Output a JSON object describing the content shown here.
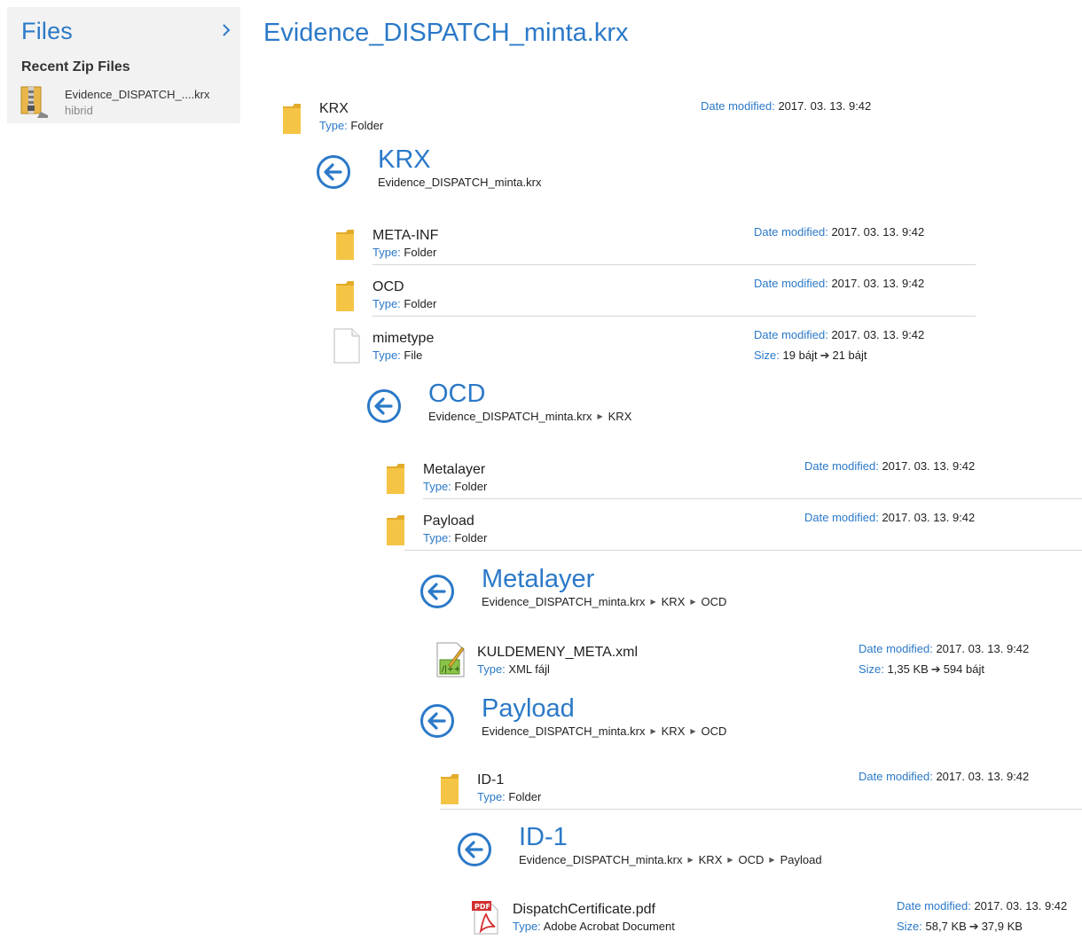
{
  "sidebar": {
    "title": "Files",
    "recent_title": "Recent Zip Files",
    "recent_item": {
      "name": "Evidence_DISPATCH_....krx",
      "sub": "hibrid"
    }
  },
  "main": {
    "title": "Evidence_DISPATCH_minta.krx"
  },
  "labels": {
    "type": "Type:",
    "date_modified": "Date modified:",
    "size": "Size:",
    "arrow": "➔"
  },
  "rows": {
    "krx": {
      "name": "KRX",
      "type": "Folder",
      "date": "2017. 03. 13. 9:42"
    },
    "metainf": {
      "name": "META-INF",
      "type": "Folder",
      "date": "2017. 03. 13. 9:42"
    },
    "ocd": {
      "name": "OCD",
      "type": "Folder",
      "date": "2017. 03. 13. 9:42"
    },
    "mimetype": {
      "name": "mimetype",
      "type": "File",
      "date": "2017. 03. 13. 9:42",
      "size_from": "19 bájt",
      "size_to": "21 bájt"
    },
    "metalayer": {
      "name": "Metalayer",
      "type": "Folder",
      "date": "2017. 03. 13. 9:42"
    },
    "payload": {
      "name": "Payload",
      "type": "Folder",
      "date": "2017. 03. 13. 9:42"
    },
    "xml": {
      "name": "KULDEMENY_META.xml",
      "type": "XML fájl",
      "date": "2017. 03. 13. 9:42",
      "size_from": "1,35 KB",
      "size_to": "594 bájt"
    },
    "id1": {
      "name": "ID-1",
      "type": "Folder",
      "date": "2017. 03. 13. 9:42"
    },
    "pdf": {
      "name": "DispatchCertificate.pdf",
      "type": "Adobe Acrobat Document",
      "date": "2017. 03. 13. 9:42",
      "size_from": "58,7 KB",
      "size_to": "37,9 KB"
    }
  },
  "sections": {
    "krx": {
      "title": "KRX",
      "crumbs": [
        "Evidence_DISPATCH_minta.krx"
      ]
    },
    "ocd": {
      "title": "OCD",
      "crumbs": [
        "Evidence_DISPATCH_minta.krx",
        "KRX"
      ]
    },
    "metalayer": {
      "title": "Metalayer",
      "crumbs": [
        "Evidence_DISPATCH_minta.krx",
        "KRX",
        "OCD"
      ]
    },
    "payload": {
      "title": "Payload",
      "crumbs": [
        "Evidence_DISPATCH_minta.krx",
        "KRX",
        "OCD"
      ]
    },
    "id1": {
      "title": "ID-1",
      "crumbs": [
        "Evidence_DISPATCH_minta.krx",
        "KRX",
        "OCD",
        "Payload"
      ]
    }
  },
  "colors": {
    "accent": "#2b79c8",
    "sidebar_bg": "#f2f2f2",
    "folder": "#f6c445"
  },
  "icons": {
    "folder": "folder-icon",
    "file": "file-icon",
    "xml": "xml-file-icon",
    "pdf": "pdf-file-icon",
    "zip": "zip-archive-icon",
    "back": "back-arrow-icon",
    "chevron": "chevron-right-icon"
  }
}
